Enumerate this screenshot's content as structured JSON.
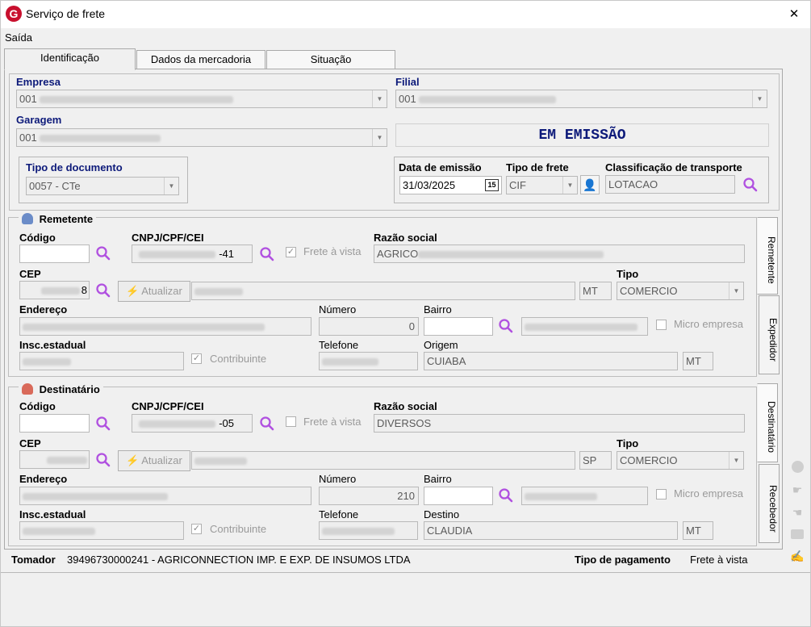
{
  "window": {
    "title": "Serviço de frete",
    "close": "✕"
  },
  "menu": {
    "saida": "Saída"
  },
  "tabs": [
    {
      "label": "Identificação"
    },
    {
      "label": "Dados da mercadoria"
    },
    {
      "label": "Situação"
    }
  ],
  "identificacao": {
    "empresa_label": "Empresa",
    "empresa_code": "001",
    "filial_label": "Filial",
    "filial_code": "001",
    "garagem_label": "Garagem",
    "garagem_code": "001",
    "status": "EM EMISSÃO",
    "tipo_doc_label": "Tipo de documento",
    "tipo_doc_value": "0057 - CTe",
    "data_emissao_label": "Data de emissão",
    "data_emissao_value": "31/03/2025",
    "calendar_badge": "15",
    "tipo_frete_label": "Tipo de frete",
    "tipo_frete_value": "CIF",
    "classificacao_label": "Classificação de transporte",
    "classificacao_value": "LOTACAO"
  },
  "remetente": {
    "title": "Remetente",
    "codigo_label": "Código",
    "cnpj_label": "CNPJ/CPF/CEI",
    "cnpj_suffix": "-41",
    "frete_vista_label": "Frete à vista",
    "razao_label": "Razão social",
    "razao_value": "AGRICO",
    "cep_label": "CEP",
    "cep_suffix": "8",
    "atualizar_label": "Atualizar",
    "uf": "MT",
    "tipo_label": "Tipo",
    "tipo_value": "COMERCIO",
    "endereco_label": "Endereço",
    "numero_label": "Número",
    "numero_value": "0",
    "bairro_label": "Bairro",
    "micro_label": "Micro empresa",
    "insc_label": "Insc.estadual",
    "contribuinte_label": "Contribuinte",
    "telefone_label": "Telefone",
    "origem_label": "Origem",
    "origem_value": "CUIABA",
    "origem_uf": "MT"
  },
  "destinatario": {
    "title": "Destinatário",
    "codigo_label": "Código",
    "cnpj_label": "CNPJ/CPF/CEI",
    "cnpj_suffix": "-05",
    "frete_vista_label": "Frete à vista",
    "razao_label": "Razão social",
    "razao_value": "DIVERSOS",
    "cep_label": "CEP",
    "atualizar_label": "Atualizar",
    "uf": "SP",
    "tipo_label": "Tipo",
    "tipo_value": "COMERCIO",
    "endereco_label": "Endereço",
    "numero_label": "Número",
    "numero_value": "210",
    "bairro_label": "Bairro",
    "micro_label": "Micro empresa",
    "insc_label": "Insc.estadual",
    "contribuinte_label": "Contribuinte",
    "telefone_label": "Telefone",
    "destino_label": "Destino",
    "destino_value": "CLAUDIA",
    "destino_uf": "MT"
  },
  "side_tabs": {
    "remetente": "Remetente",
    "expedidor": "Expedidor",
    "destinatario": "Destinatário",
    "recebedor": "Recebedor"
  },
  "footer": {
    "tomador_label": "Tomador",
    "tomador_value": "39496730000241 - AGRICONNECTION IMP. E EXP. DE INSUMOS LTDA",
    "pagamento_label": "Tipo de pagamento",
    "pagamento_value": "Frete à vista"
  },
  "colors": {
    "accent_label": "#0d1a7a",
    "magnifier": "#b050e0",
    "logo": "#c8102e"
  }
}
